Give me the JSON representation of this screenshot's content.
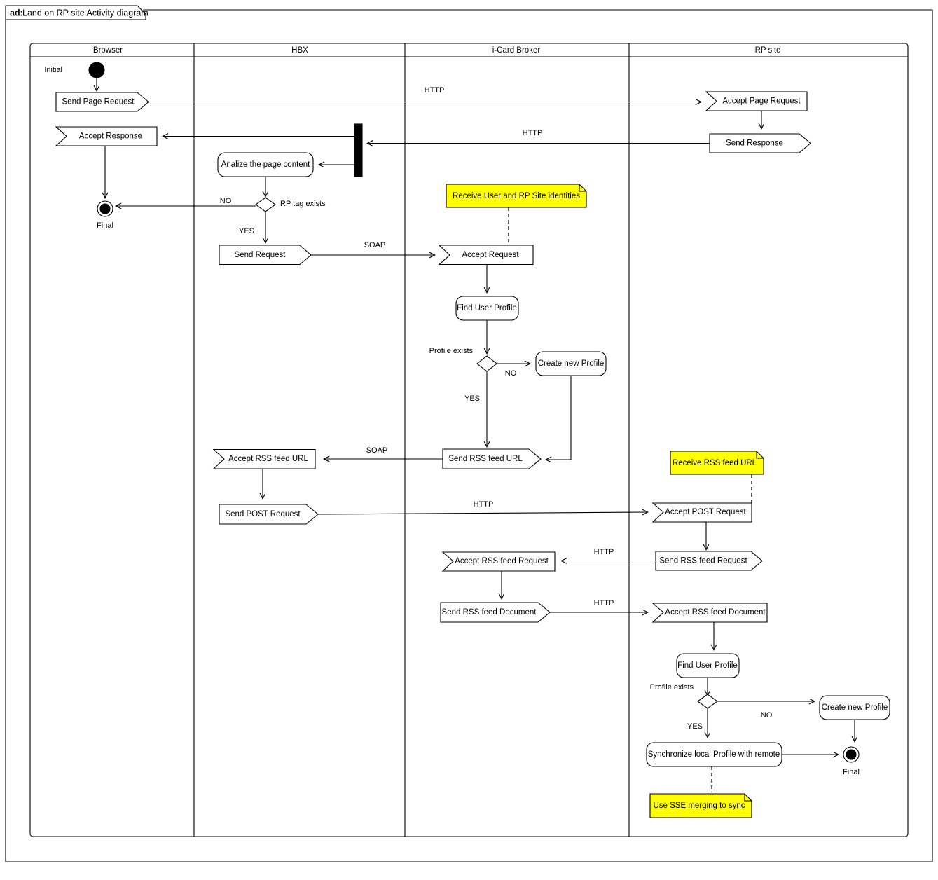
{
  "frame": {
    "tag_prefix": "ad:",
    "tag_title": "Land on RP site Activity diagram"
  },
  "lanes": [
    {
      "id": "browser",
      "label": "Browser"
    },
    {
      "id": "hbx",
      "label": "HBX"
    },
    {
      "id": "icard",
      "label": "i-Card Broker"
    },
    {
      "id": "rpsite",
      "label": "RP site"
    }
  ],
  "nodes": {
    "initial_label": "Initial",
    "final_label_browser": "Final",
    "final_label_rpsite": "Final",
    "send_page_request": "Send Page Request",
    "accept_page_request": "Accept Page Request",
    "send_response": "Send Response",
    "accept_response": "Accept Response",
    "analize_page_content": "Analize the page content",
    "rp_tag_exists": "RP tag exists",
    "send_request": "Send Request",
    "accept_request": "Accept Request",
    "find_user_profile_icard": "Find User Profile",
    "profile_exists_icard": "Profile exists",
    "create_new_profile_icard": "Create new Profile",
    "send_rss_feed_url": "Send RSS feed URL",
    "accept_rss_feed_url": "Accept RSS feed URL",
    "send_post_request": "Send POST Request",
    "accept_post_request": "Accept POST Request",
    "send_rss_feed_request": "Send RSS feed Request",
    "accept_rss_feed_request": "Accept RSS feed Request",
    "send_rss_feed_document": "Send RSS feed Document",
    "accept_rss_feed_document": "Accept RSS feed Document",
    "find_user_profile_rp": "Find User Profile",
    "profile_exists_rp": "Profile exists",
    "create_new_profile_rp": "Create new Profile",
    "synchronize_local_profile": "Synchronize local Profile with remote"
  },
  "notes": [
    {
      "id": "note-identities",
      "text": "Receive User and RP  Site identities",
      "color": "#ffff00"
    },
    {
      "id": "note-rss-url",
      "text": "Receive RSS feed URL",
      "color": "#ffff00"
    },
    {
      "id": "note-sse",
      "text": "Use SSE merging to sync",
      "color": "#ffff00"
    }
  ],
  "edge_labels": {
    "http_page_request": "HTTP",
    "http_response": "HTTP",
    "no_rp_tag": "NO",
    "yes_rp_tag": "YES",
    "soap_request": "SOAP",
    "no_profile_icard": "NO",
    "yes_profile_icard": "YES",
    "soap_rss_url": "SOAP",
    "http_post_request": "HTTP",
    "http_rss_request": "HTTP",
    "http_rss_document": "HTTP",
    "no_profile_rp": "NO",
    "yes_profile_rp": "YES"
  },
  "colors": {
    "note_fill": "#ffff00",
    "shape_fill": "#ffffff",
    "line": "#000000",
    "page_background": "#ffffff"
  }
}
